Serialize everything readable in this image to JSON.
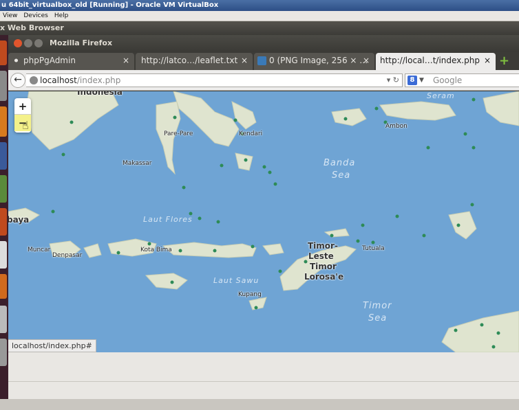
{
  "vbox": {
    "title": "u 64bit_virtualbox_old [Running] - Oracle VM VirtualBox",
    "menu": [
      "View",
      "Devices",
      "Help"
    ]
  },
  "ubuntu_panel": {
    "title": "x Web Browser"
  },
  "firefox": {
    "window_title": "Mozilla Firefox",
    "tabs": [
      {
        "label": "phpPgAdmin",
        "icon": "elephant-icon"
      },
      {
        "label": "http://latco…/leaflet.txt",
        "icon": "page-icon"
      },
      {
        "label": "0 (PNG Image, 256 × …",
        "icon": "image-icon"
      },
      {
        "label": "http://local…t/index.php",
        "icon": "page-icon"
      }
    ],
    "url": {
      "host": "localhost",
      "path": "/index.php"
    },
    "search_placeholder": "Google",
    "status_text": "localhost/index.php#"
  },
  "map": {
    "zoom_in": "+",
    "zoom_out": "−",
    "labels": {
      "indonesia": "Indonesia",
      "pare_pare": "Pare-Pare",
      "kendari": "Kendari",
      "makassar": "Makassar",
      "ambon": "Ambon",
      "seram": "Seram",
      "banda_1": "Banda",
      "banda_2": "Sea",
      "laut_flores": "Laut Flores",
      "baya": "baya",
      "muncar": "Muncar",
      "denpasar": "Denpasar",
      "kota_bima": "Kota Bima",
      "laut_sawu": "Laut Sawu",
      "kupang": "Kupang",
      "timor_leste_1": "Timor-",
      "timor_leste_2": "Leste",
      "timor_leste_3": "Timor",
      "timor_leste_4": "Lorosa'e",
      "tutuala": "Tutuala",
      "timor_sea_1": "Timor",
      "timor_sea_2": "Sea"
    },
    "colors": {
      "sea": "#6fa4d4",
      "land": "#dfe4cf",
      "marker": "#2e8b57"
    }
  }
}
